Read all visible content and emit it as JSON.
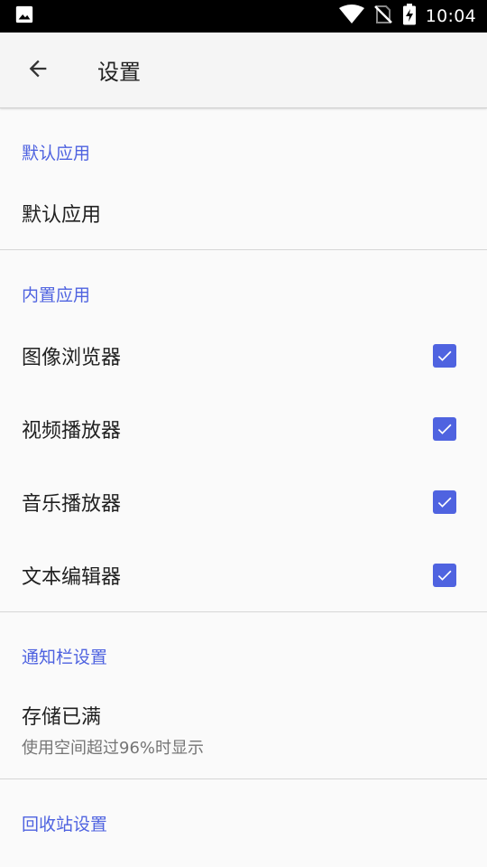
{
  "status_bar": {
    "time": "10:04",
    "icons": [
      "image-notification-icon",
      "wifi-icon",
      "no-signal-icon",
      "battery-charging-icon"
    ]
  },
  "app_bar": {
    "title": "设置",
    "back_icon": "arrow-back-icon"
  },
  "sections": {
    "default_apps": {
      "header": "默认应用",
      "item_title": "默认应用"
    },
    "builtin_apps": {
      "header": "内置应用",
      "items": [
        {
          "title": "图像浏览器",
          "checked": true
        },
        {
          "title": "视频播放器",
          "checked": true
        },
        {
          "title": "音乐播放器",
          "checked": true
        },
        {
          "title": "文本编辑器",
          "checked": true
        }
      ]
    },
    "notification": {
      "header": "通知栏设置",
      "item_title": "存储已满",
      "item_summary": "使用空间超过96%时显示"
    },
    "recycle_bin": {
      "header": "回收站设置"
    }
  },
  "colors": {
    "accent": "#4f63e0",
    "statusbar_bg": "#000000",
    "appbar_bg": "#f5f5f5",
    "background": "#fafafa"
  }
}
